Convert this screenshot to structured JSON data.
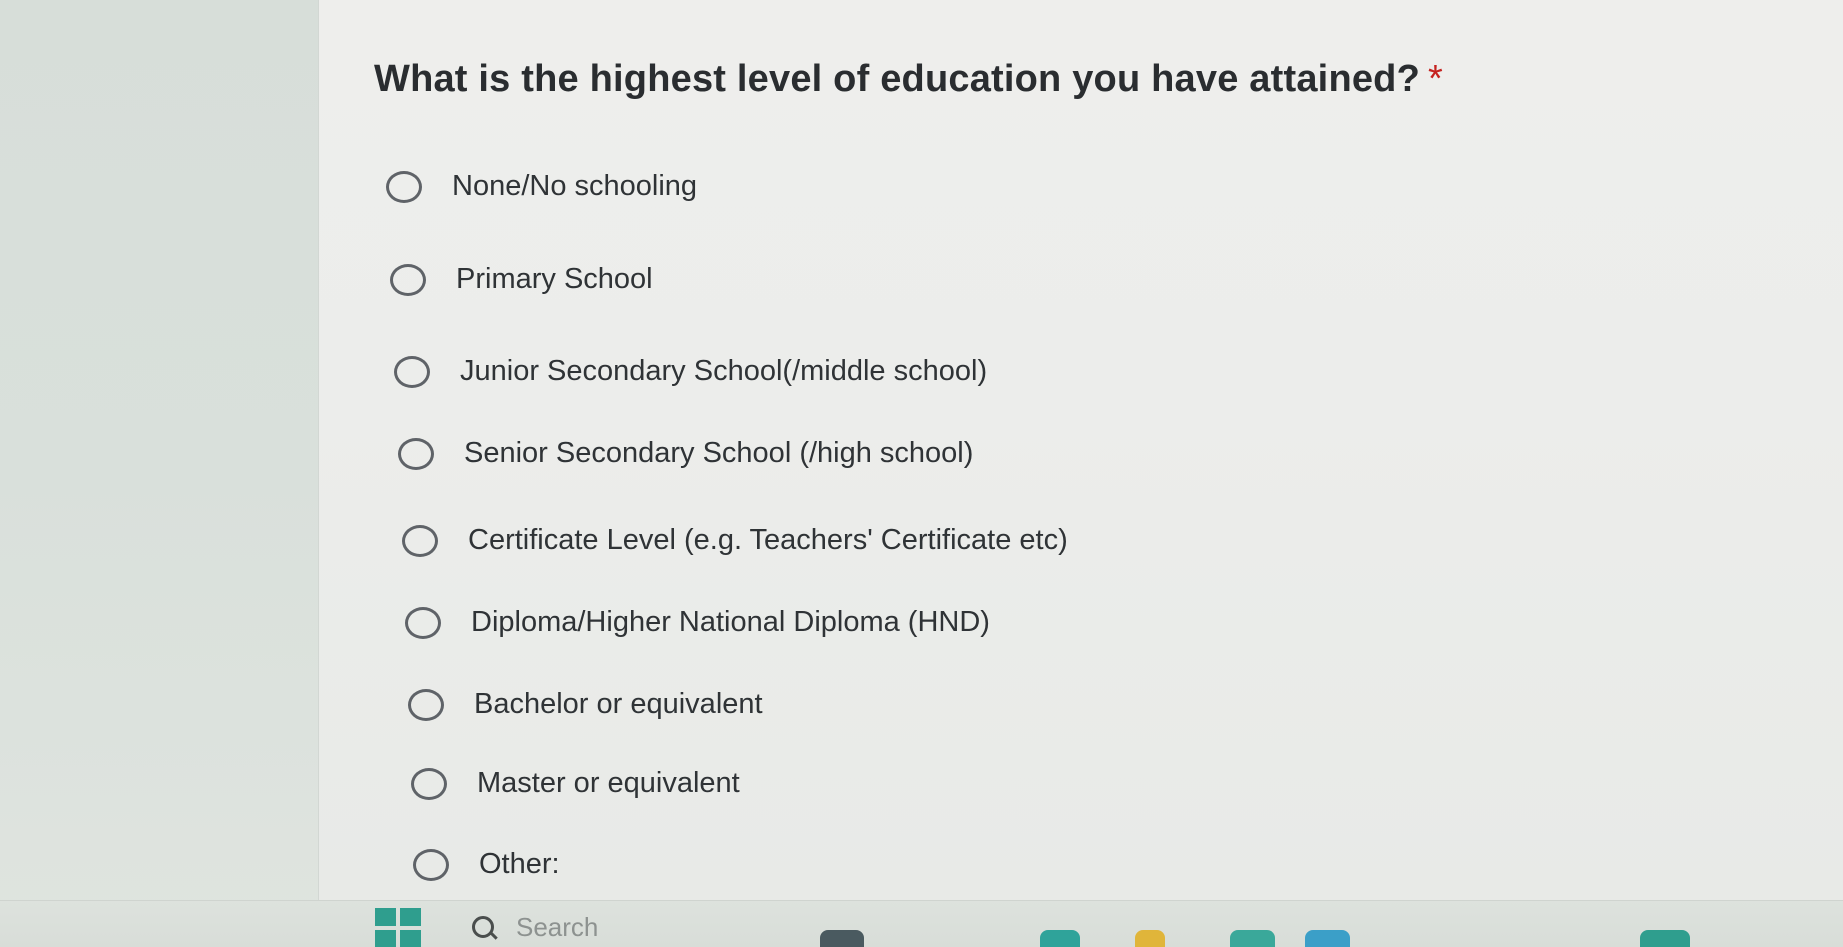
{
  "question": {
    "title": "What is the highest level of education you have attained?",
    "required_marker": "*"
  },
  "options": [
    {
      "label": "None/No schooling",
      "selected": false
    },
    {
      "label": "Primary School",
      "selected": false
    },
    {
      "label": "Junior Secondary School(/middle school)",
      "selected": false
    },
    {
      "label": "Senior Secondary School (/high school)",
      "selected": false
    },
    {
      "label": "Certificate Level (e.g. Teachers' Certificate etc)",
      "selected": false
    },
    {
      "label": "Diploma/Higher National Diploma (HND)",
      "selected": false
    },
    {
      "label": "Bachelor or equivalent",
      "selected": false
    },
    {
      "label": "Master or equivalent",
      "selected": false
    },
    {
      "label": "Other:",
      "selected": false
    }
  ],
  "taskbar": {
    "search_placeholder": "Search",
    "start_icon": "windows-logo-icon",
    "search_icon": "search-icon"
  },
  "colors": {
    "radio_border": "#5f6368",
    "required_star": "#c5221f",
    "question_text": "#2a2d30"
  }
}
